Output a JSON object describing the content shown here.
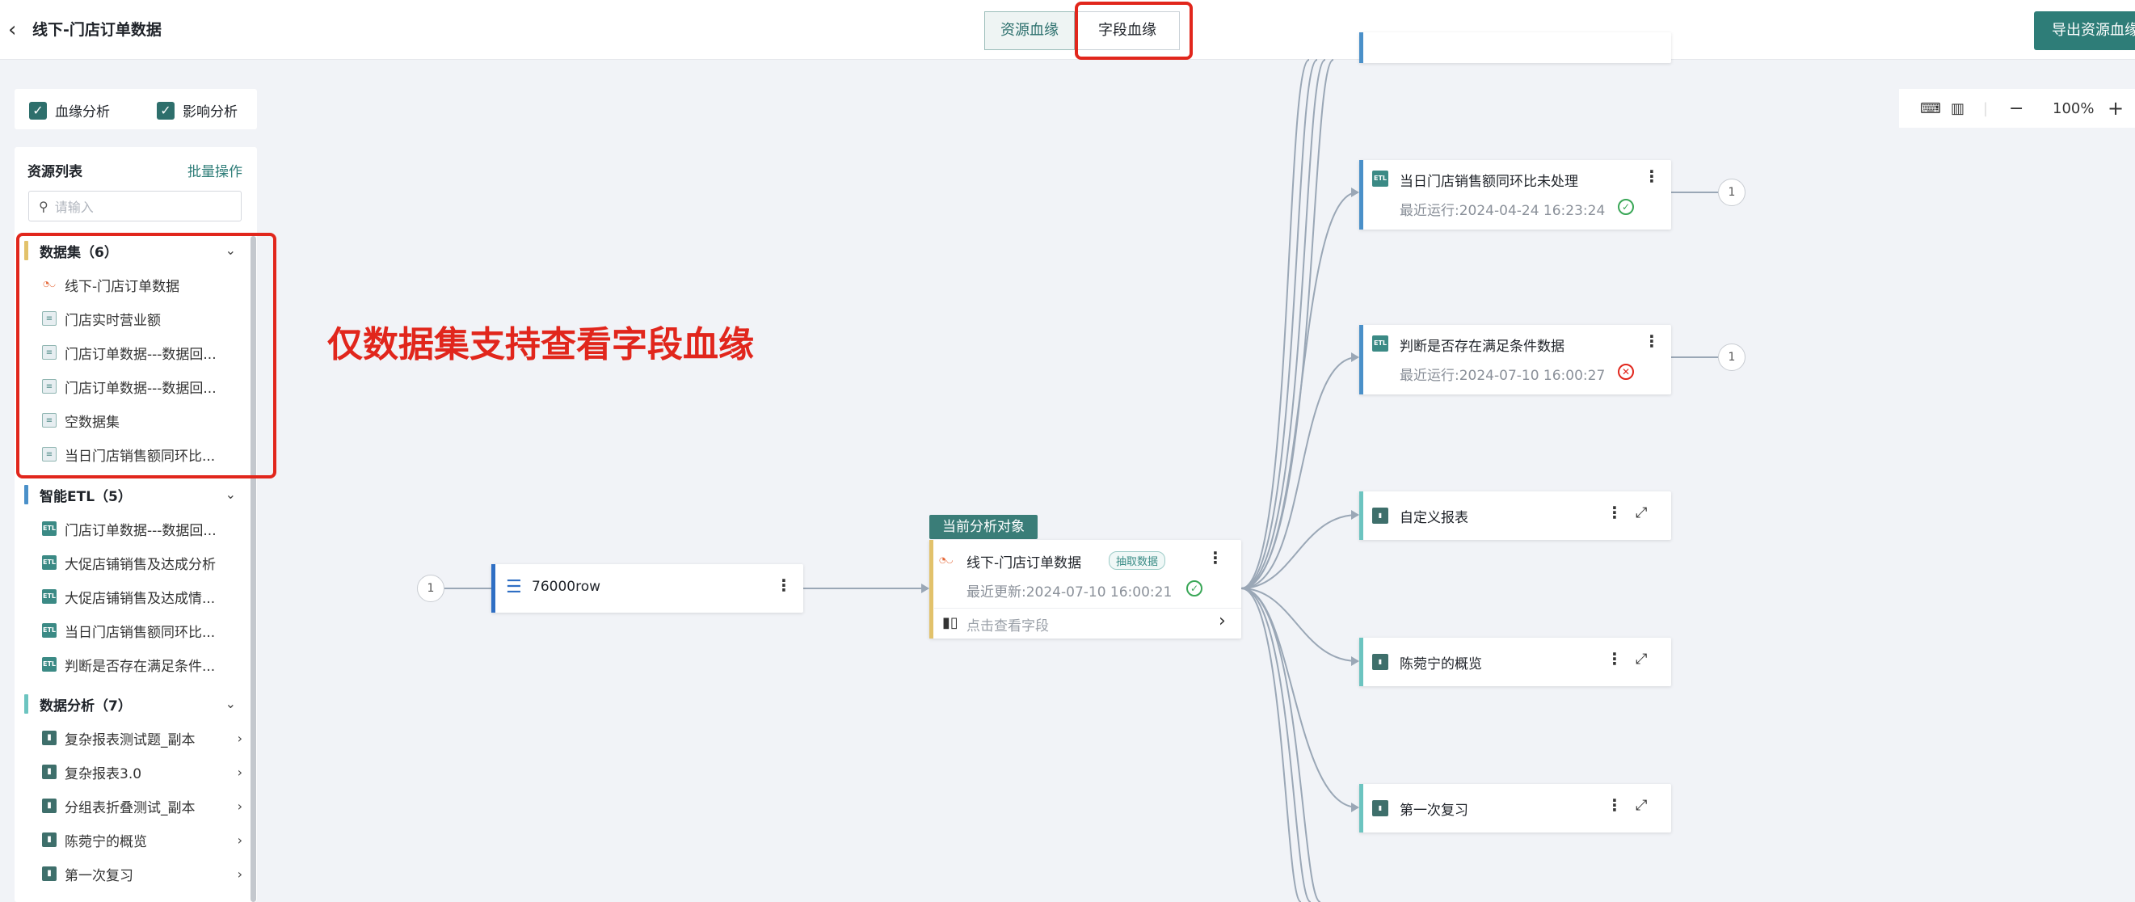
{
  "header": {
    "back_icon": "chevron-left-icon",
    "title": "线下-门店订单数据",
    "tabs": [
      {
        "label": "资源血缘",
        "active": false
      },
      {
        "label": "字段血缘",
        "active": true
      }
    ],
    "export_label": "导出资源血缘"
  },
  "filters": [
    {
      "label": "血缘分析",
      "checked": true
    },
    {
      "label": "影响分析",
      "checked": true
    }
  ],
  "resource_panel": {
    "title": "资源列表",
    "batch_label": "批量操作",
    "search_placeholder": "请输入",
    "groups": [
      {
        "label": "数据集（6）",
        "color": "#e2c26b",
        "items": [
          "线下-门店订单数据",
          "门店实时营业额",
          "门店订单数据---数据回...",
          "门店订单数据---数据回...",
          "空数据集",
          "当日门店销售额同环比..."
        ]
      },
      {
        "label": "智能ETL（5）",
        "color": "#4a90c9",
        "items": [
          "门店订单数据---数据回...",
          "大促店铺销售及达成分析",
          "大促店铺销售及达成情...",
          "当日门店销售额同环比...",
          "判断是否存在满足条件..."
        ]
      },
      {
        "label": "数据分析（7）",
        "color": "#6cc4c0",
        "items": [
          "复杂报表测试题_副本",
          "复杂报表3.0",
          "分组表折叠测试_副本",
          "陈菀宁的概览",
          "第一次复习"
        ]
      }
    ]
  },
  "zoom": {
    "level": "100%"
  },
  "annotation": "仅数据集支持查看字段血缘",
  "nodes": {
    "source": {
      "title": "76000row",
      "count": "1"
    },
    "current_badge": "当前分析对象",
    "current": {
      "title": "线下-门店订单数据",
      "tag": "抽取数据",
      "updated": "最近更新:2024-07-10 16:00:21",
      "field_link": "点击查看字段"
    },
    "etl1": {
      "title": "当日门店销售额同环比未处理",
      "run": "最近运行:2024-04-24 16:23:24",
      "count": "1"
    },
    "etl2": {
      "title": "判断是否存在满足条件数据",
      "run": "最近运行:2024-07-10 16:00:27",
      "count": "1"
    },
    "report1": {
      "title": "自定义报表"
    },
    "report2": {
      "title": "陈菀宁的概览"
    },
    "report3": {
      "title": "第一次复习"
    }
  }
}
